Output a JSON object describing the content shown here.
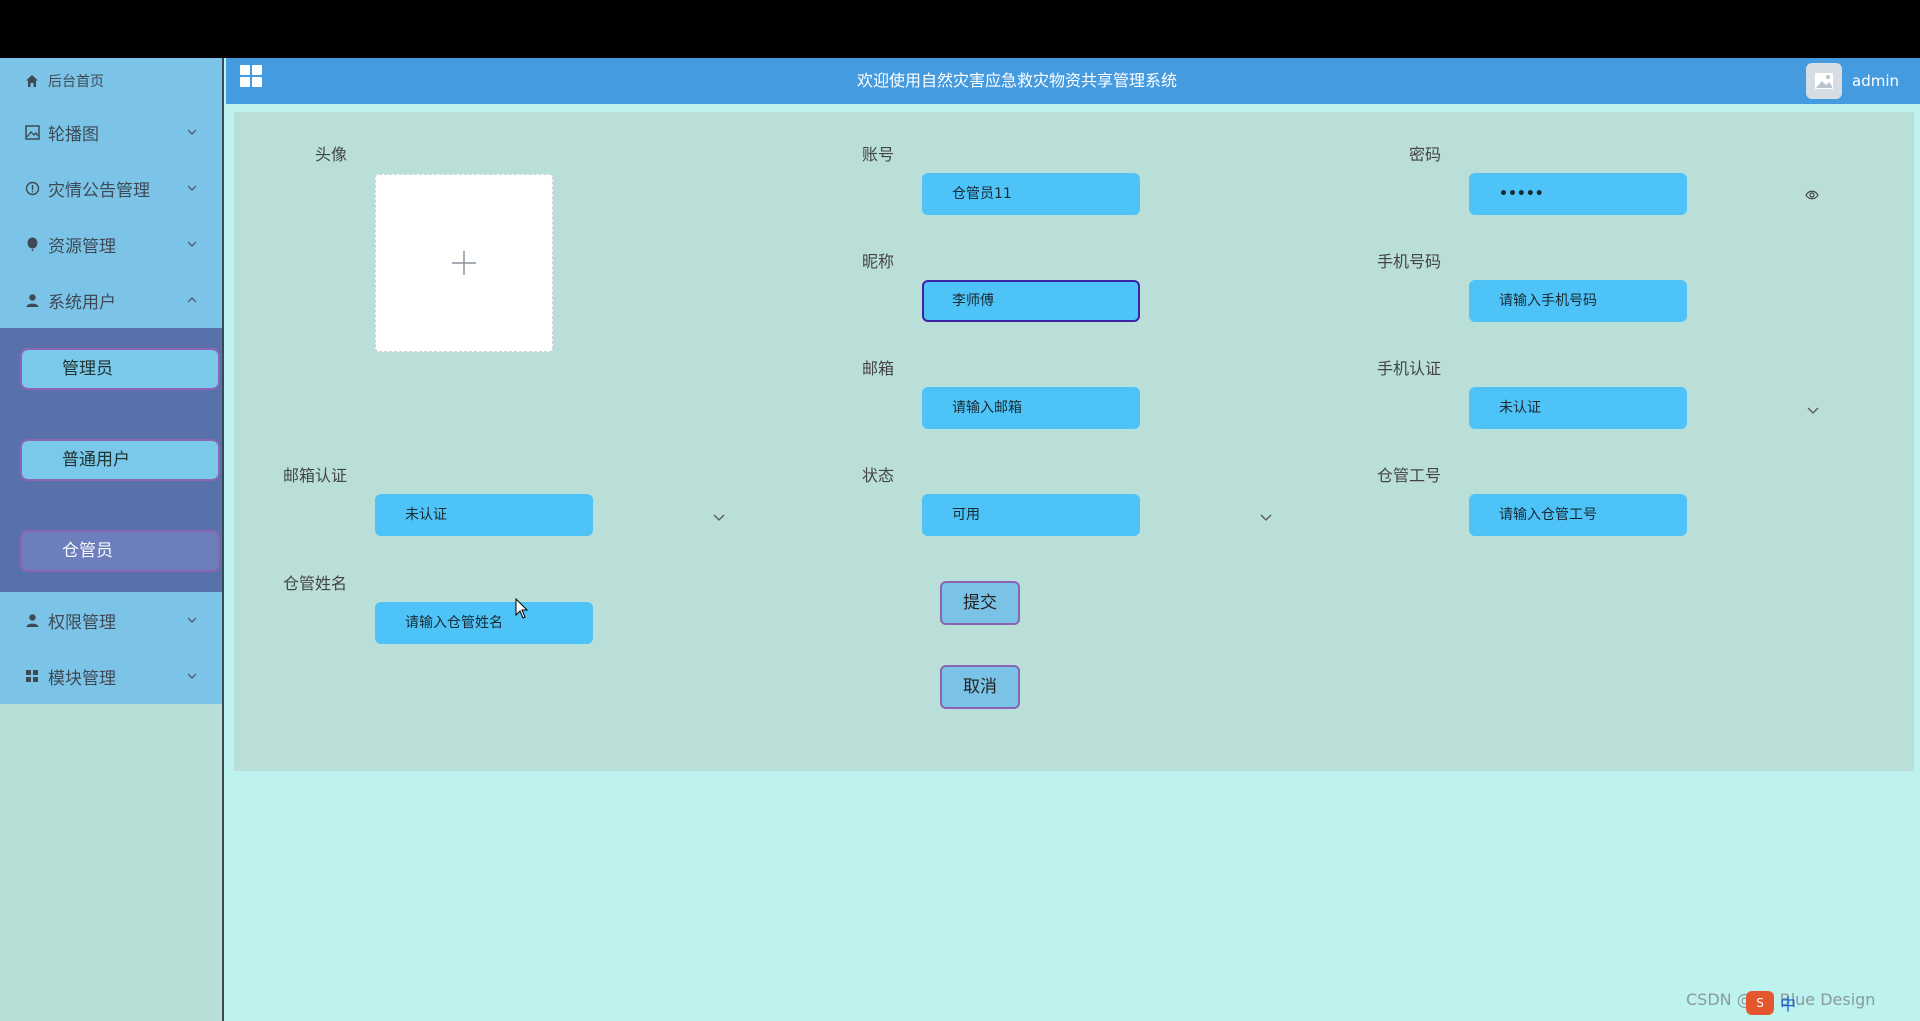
{
  "sidebar": {
    "home": "后台首页",
    "items": [
      {
        "label": "轮播图"
      },
      {
        "label": "灾情公告管理"
      },
      {
        "label": "资源管理"
      },
      {
        "label": "系统用户"
      }
    ],
    "sub_items": [
      {
        "label": "管理员"
      },
      {
        "label": "普通用户"
      },
      {
        "label": "仓管员"
      }
    ],
    "bottom_items": [
      {
        "label": "权限管理"
      },
      {
        "label": "模块管理"
      }
    ]
  },
  "header": {
    "title": "欢迎使用自然灾害应急救灾物资共享管理系统",
    "user": "admin"
  },
  "form": {
    "avatar_label": "头像",
    "account_label": "账号",
    "account_value": "仓管员11",
    "password_label": "密码",
    "password_value": "•••••",
    "nickname_label": "昵称",
    "nickname_value": "李师傅",
    "phone_label": "手机号码",
    "phone_placeholder": "请输入手机号码",
    "email_label": "邮箱",
    "email_placeholder": "请输入邮箱",
    "phone_verify_label": "手机认证",
    "phone_verify_value": "未认证",
    "email_verify_label": "邮箱认证",
    "email_verify_value": "未认证",
    "status_label": "状态",
    "status_value": "可用",
    "staff_id_label": "仓管工号",
    "staff_id_placeholder": "请输入仓管工号",
    "staff_name_label": "仓管姓名",
    "staff_name_placeholder": "请输入仓管姓名",
    "submit": "提交",
    "cancel": "取消"
  },
  "watermark": "CSDN @XZ Blue Design",
  "ime": "中",
  "colors": {
    "header": "#459be0",
    "sidebar": "#7cc4e7",
    "submenu": "#5971aa",
    "input": "#4ec3f7",
    "panel": "#badfd8",
    "page": "#bdf2ef"
  }
}
